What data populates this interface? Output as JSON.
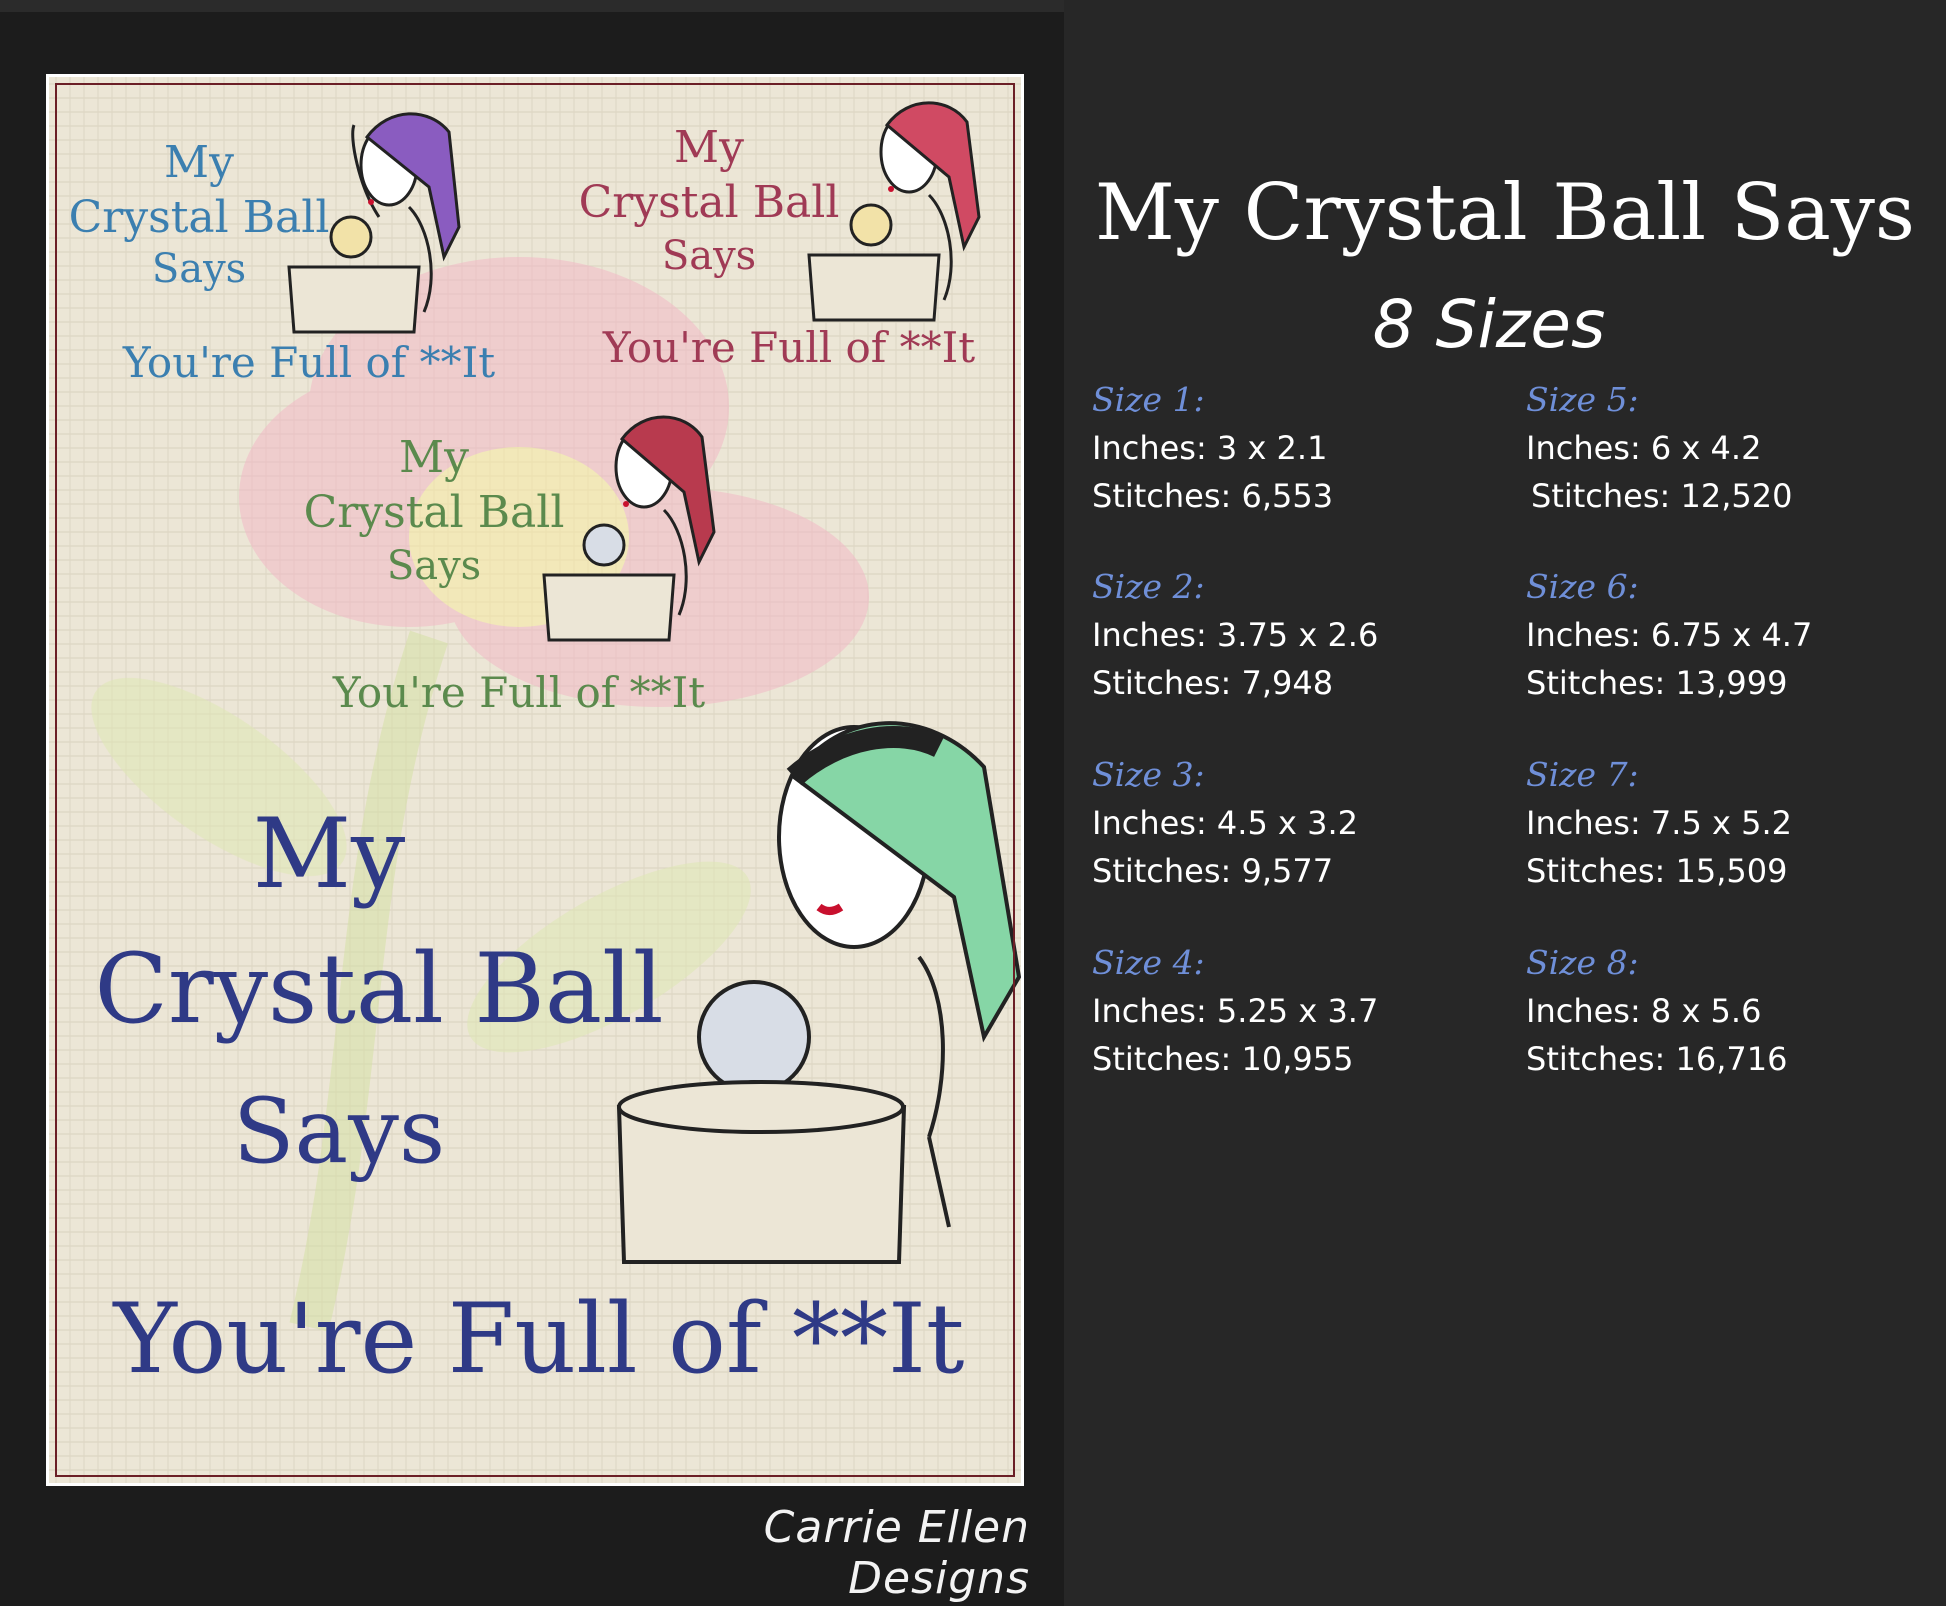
{
  "poster": {
    "design_small_1": {
      "line1": "My",
      "line2": "Crystal Ball",
      "line3": "Says",
      "tagline": "You're Full of **It",
      "color": "#3b7fb0",
      "scarf_color": "#8a5cc0"
    },
    "design_small_2": {
      "line1": "My",
      "line2": "Crystal Ball",
      "line3": "Says",
      "tagline": "You're Full of **It",
      "color": "#a03a55",
      "scarf_color": "#d04a63"
    },
    "design_small_3": {
      "line1": "My",
      "line2": "Crystal Ball",
      "line3": "Says",
      "tagline": "You're Full of **It",
      "color": "#5b8a4d",
      "scarf_color": "#b83a4e"
    },
    "design_large": {
      "line1": "My",
      "line2": "Crystal Ball",
      "line3": "Says",
      "tagline": "You're Full of **It",
      "color": "#2f3a86",
      "scarf_color": "#86d6a6"
    },
    "signature": "Carrie Ellen Designs"
  },
  "info": {
    "title": "My Crystal Ball Says",
    "subtitle": "8 Sizes",
    "sizes": [
      {
        "label": "Size 1:",
        "inches": "Inches: 3 x 2.1",
        "stitches": "Stitches: 6,553"
      },
      {
        "label": "Size 2:",
        "inches": "Inches: 3.75 x 2.6",
        "stitches": "Stitches: 7,948"
      },
      {
        "label": "Size 3:",
        "inches": "Inches: 4.5 x 3.2",
        "stitches": "Stitches: 9,577"
      },
      {
        "label": "Size 4:",
        "inches": "Inches: 5.25 x 3.7",
        "stitches": "Stitches: 10,955"
      },
      {
        "label": "Size 5:",
        "inches": "Inches: 6 x 4.2",
        "stitches": "Stitches: 12,520"
      },
      {
        "label": "Size 6:",
        "inches": "Inches: 6.75 x 4.7",
        "stitches": "Stitches: 13,999"
      },
      {
        "label": "Size 7:",
        "inches": "Inches: 7.5 x 5.2",
        "stitches": "Stitches: 15,509"
      },
      {
        "label": "Size 8:",
        "inches": "Inches: 8 x 5.6",
        "stitches": "Stitches: 16,716"
      }
    ],
    "label_color": "#6f8fd8"
  }
}
